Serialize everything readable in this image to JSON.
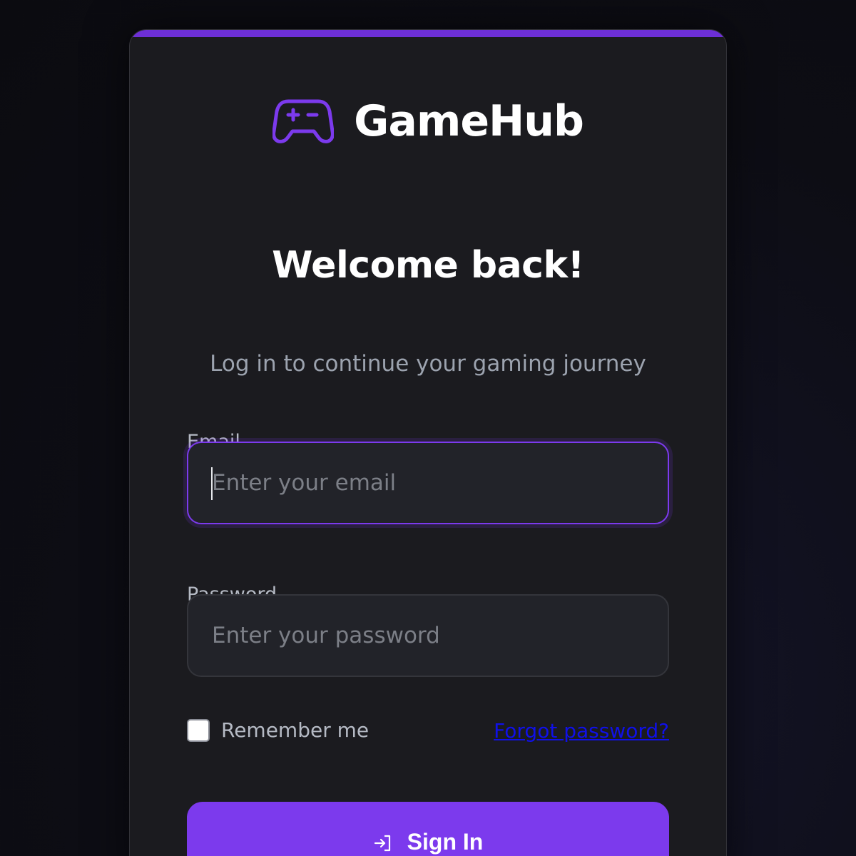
{
  "brand": {
    "name": "GameHub",
    "accent_color": "#7c3aed",
    "logo_icon": "gamepad-icon"
  },
  "heading": "Welcome back!",
  "subtitle": "Log in to continue your gaming journey",
  "form": {
    "email": {
      "label": "Email",
      "placeholder": "Enter your email",
      "value": ""
    },
    "password": {
      "label": "Password",
      "placeholder": "Enter your password",
      "value": ""
    },
    "remember_me": {
      "label": "Remember me",
      "checked": false
    },
    "forgot_password_link": "Forgot password?",
    "submit": {
      "label": "Sign In",
      "icon": "sign-in-icon"
    }
  }
}
